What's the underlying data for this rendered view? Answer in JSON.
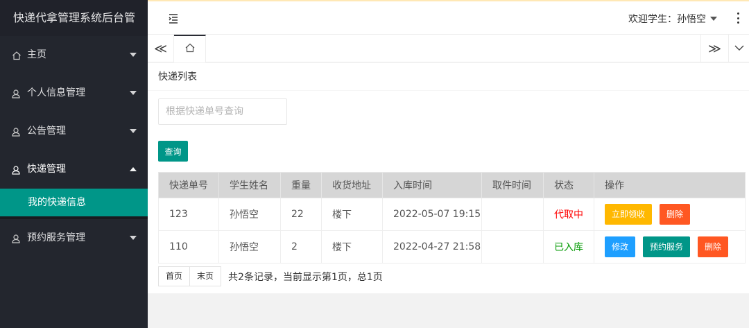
{
  "app": {
    "title": "快递代拿管理系统后台管"
  },
  "sidebar": {
    "items": [
      {
        "label": "主页",
        "icon": "home-icon"
      },
      {
        "label": "个人信息管理",
        "icon": "user-icon"
      },
      {
        "label": "公告管理",
        "icon": "user-icon"
      },
      {
        "label": "快递管理",
        "icon": "user-icon"
      },
      {
        "label": "预约服务管理",
        "icon": "user-icon"
      }
    ],
    "active_sub": "我的快递信息"
  },
  "header": {
    "welcome": "欢迎学生：孙悟空"
  },
  "tabs": {
    "prev": "≪",
    "next": "≫"
  },
  "content": {
    "title": "快递列表",
    "search_placeholder": "根据快递单号查询",
    "search_button": "查询"
  },
  "table": {
    "headers": [
      "快递单号",
      "学生姓名",
      "重量",
      "收货地址",
      "入库时间",
      "取件时间",
      "状态",
      "操作"
    ],
    "rows": [
      {
        "no": "123",
        "name": "孙悟空",
        "weight": "22",
        "address": "楼下",
        "in_time": "2022-05-07 19:15",
        "pick_time": "",
        "status": "代取中",
        "actions": [
          "立即领收",
          "删除"
        ]
      },
      {
        "no": "110",
        "name": "孙悟空",
        "weight": "2",
        "address": "楼下",
        "in_time": "2022-04-27 21:58",
        "pick_time": "",
        "status": "已入库",
        "actions": [
          "修改",
          "预约服务",
          "删除"
        ]
      }
    ]
  },
  "pager": {
    "first": "首页",
    "last": "末页",
    "info": "共2条记录，当前显示第1页，总1页"
  },
  "colors": {
    "accent": "#009688",
    "sidebar": "#23262e",
    "warn": "#ffb800",
    "danger": "#ff5722",
    "normal": "#1e9fff"
  }
}
